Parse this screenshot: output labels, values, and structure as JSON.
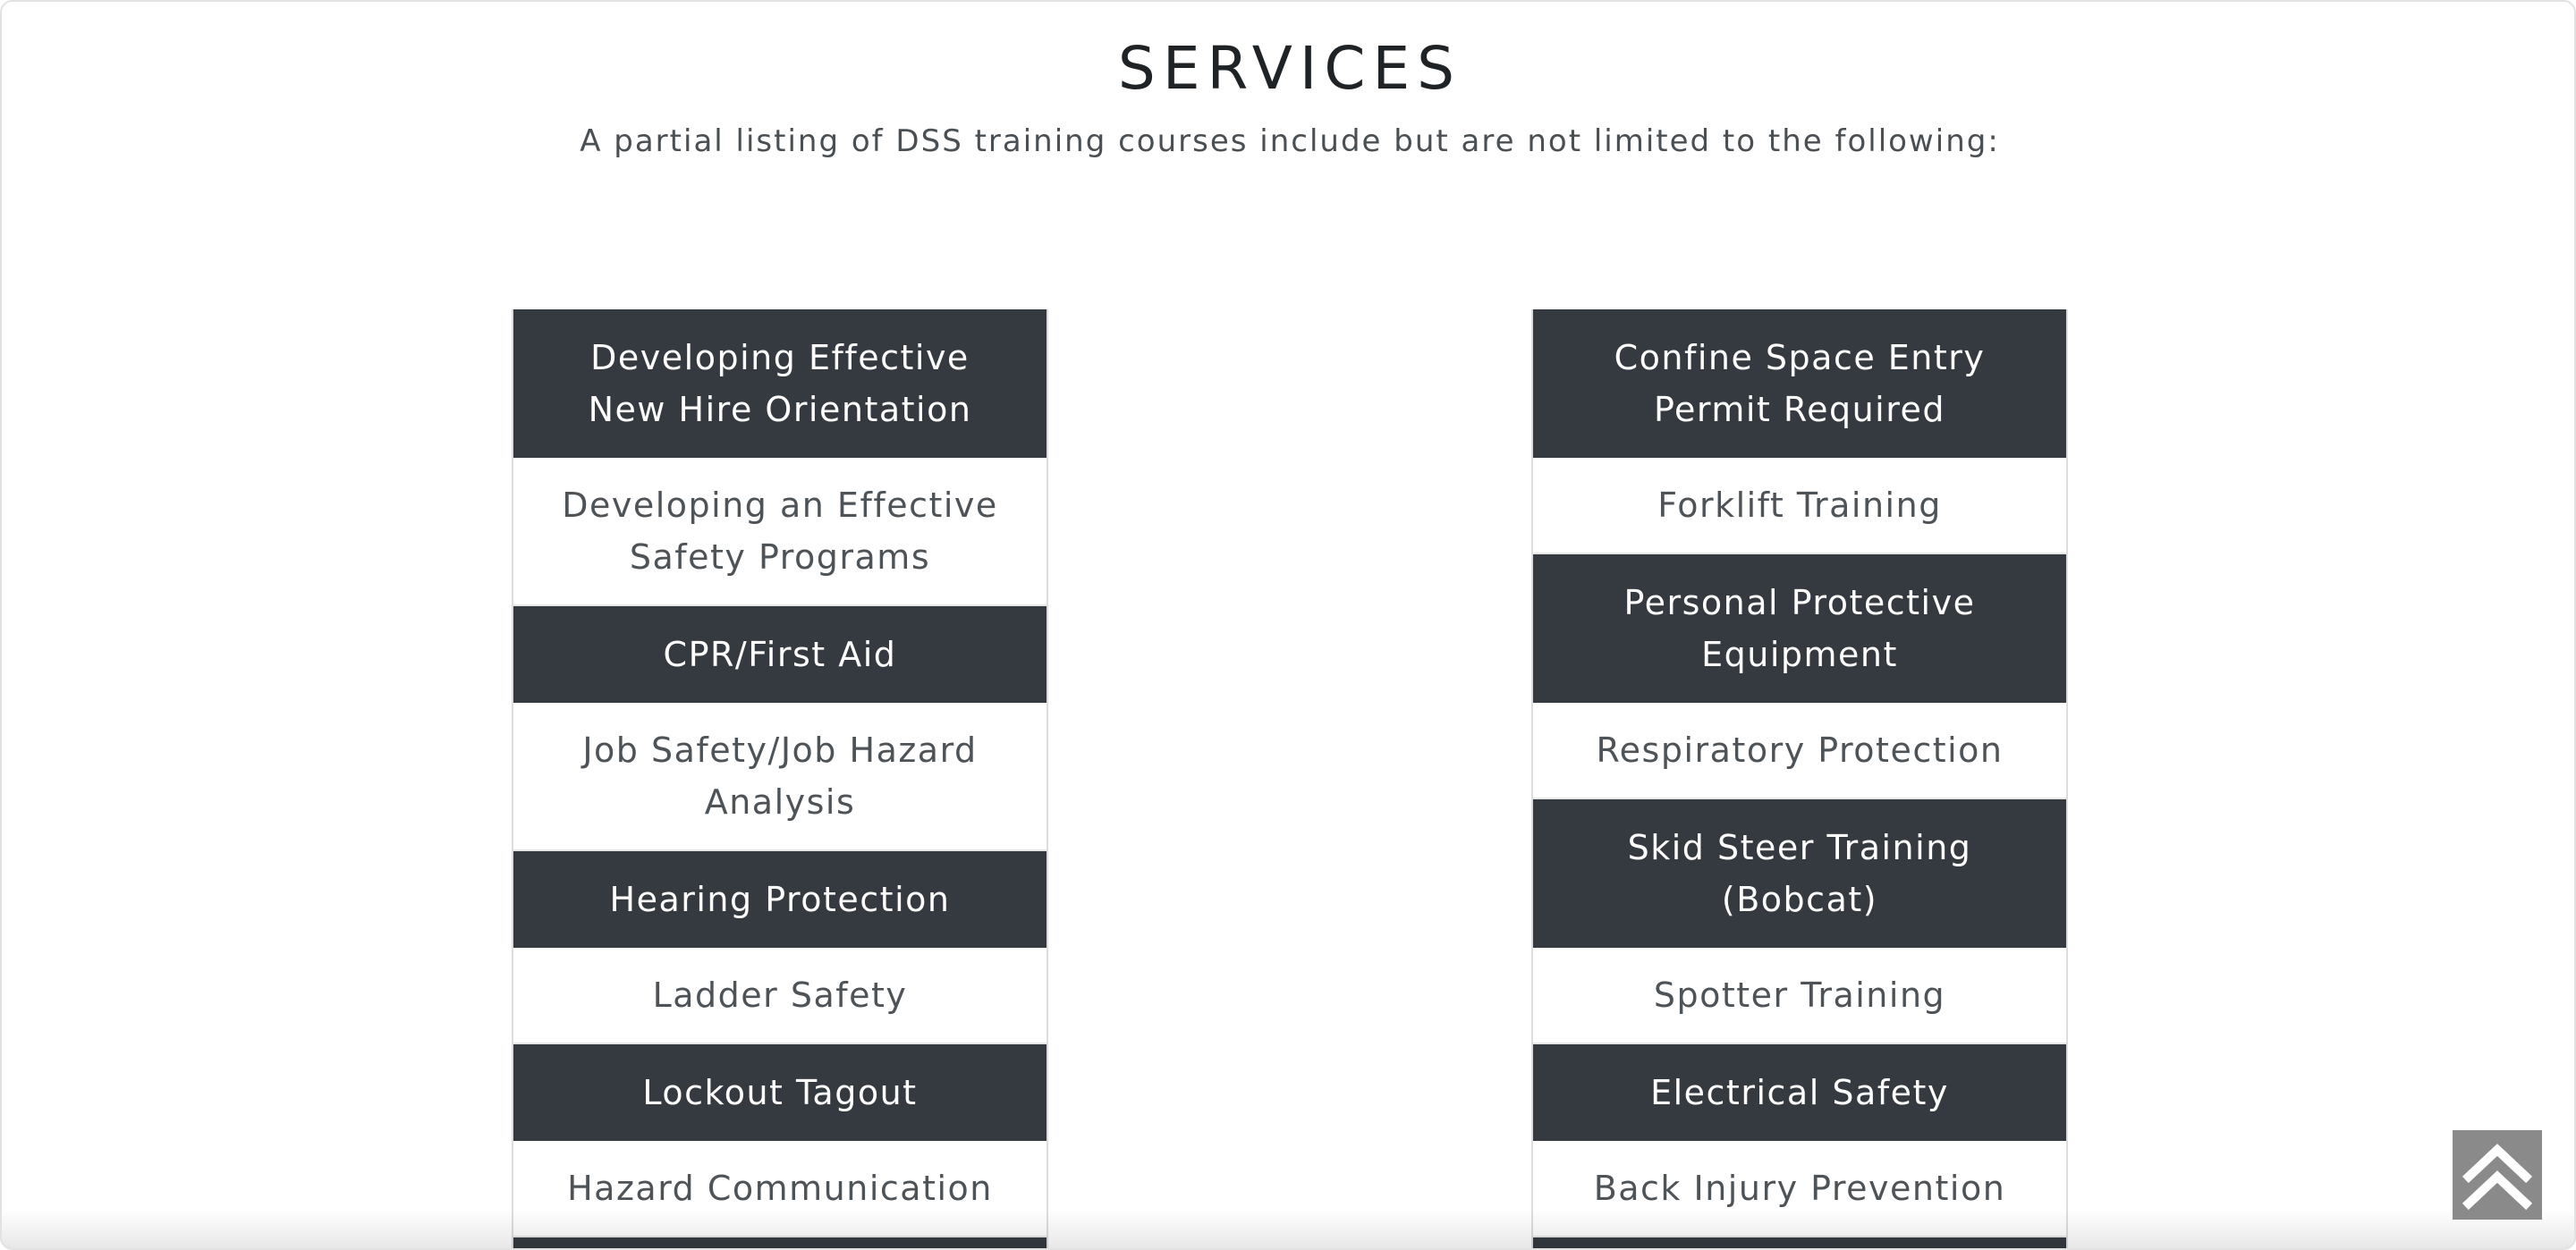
{
  "header": {
    "title": "SERVICES",
    "subtitle": "A partial listing of DSS training courses include but are not limited to the following:"
  },
  "left_column": {
    "items": [
      {
        "label": "Developing Effective New Hire Orientation"
      },
      {
        "label": "Developing an Effective Safety Programs"
      },
      {
        "label": "CPR/First Aid"
      },
      {
        "label": "Job Safety/Job Hazard Analysis"
      },
      {
        "label": "Hearing Protection"
      },
      {
        "label": "Ladder Safety"
      },
      {
        "label": "Lockout Tagout"
      },
      {
        "label": "Hazard Communication"
      }
    ]
  },
  "right_column": {
    "items": [
      {
        "label": "Confine Space Entry Permit Required"
      },
      {
        "label": "Forklift Training"
      },
      {
        "label": "Personal Protective Equipment"
      },
      {
        "label": "Respiratory Protection"
      },
      {
        "label": "Skid Steer Training (Bobcat)"
      },
      {
        "label": "Spotter Training"
      },
      {
        "label": "Electrical Safety"
      },
      {
        "label": "Back Injury Prevention"
      }
    ]
  },
  "scroll_top_button": {
    "icon": "double-chevron-up-icon"
  },
  "colors": {
    "dark_row": "#343a40",
    "light_row": "#ffffff",
    "scroll_button": "#8a8a8a"
  }
}
